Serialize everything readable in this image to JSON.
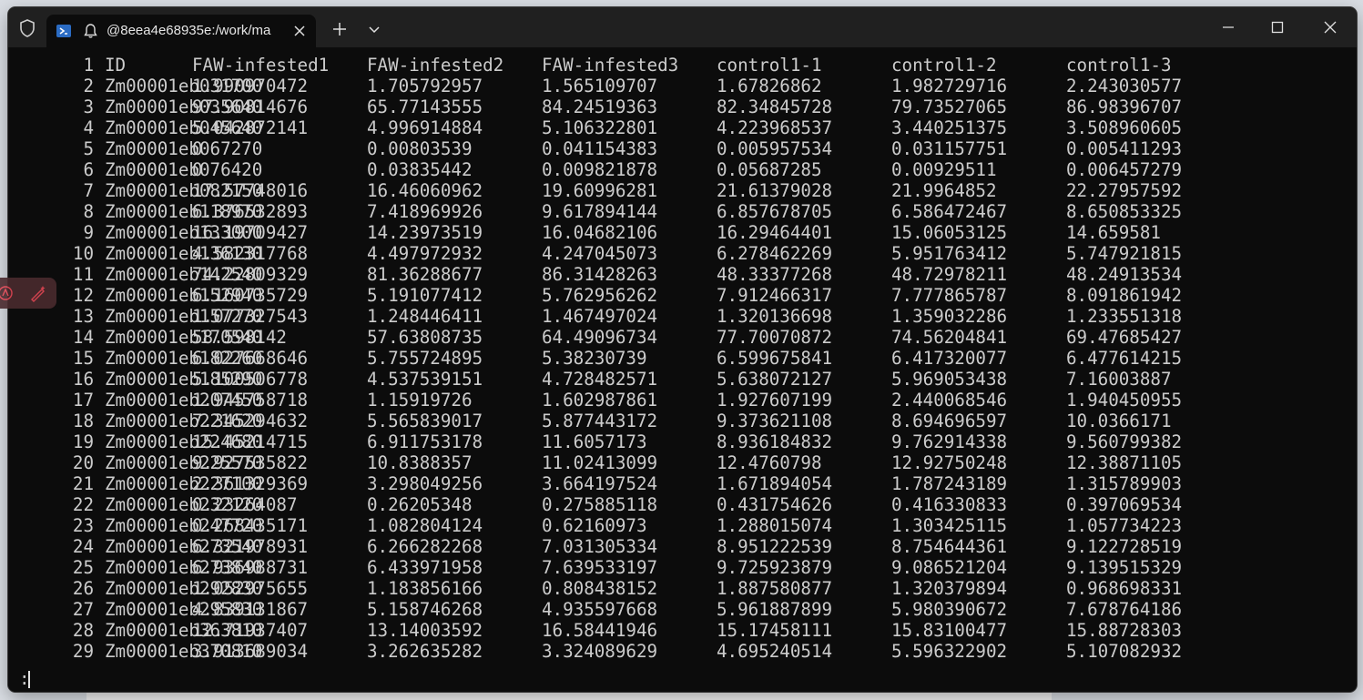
{
  "window": {
    "tab_title": "@8eea4e68935e:/work/ma"
  },
  "icons": {
    "shield": "shield-icon",
    "powershell": "powershell-icon",
    "bell": "bell-icon",
    "close_tab": "close-icon",
    "new_tab": "plus-icon",
    "dropdown": "chevron-down-icon",
    "minimize": "minimize-icon",
    "maximize": "maximize-icon",
    "close_window": "close-icon",
    "overlay_left": "accessibility-icon",
    "overlay_right": "pen-sparkle-icon"
  },
  "colors": {
    "terminal_bg": "#0c0c0c",
    "terminal_fg": "#cccccc",
    "titlebar_bg": "#202020",
    "overlay_accent": "#e74856"
  },
  "terminal": {
    "prompt": ":",
    "header": [
      "ID",
      "FAW-infested1",
      "FAW-infested2",
      "FAW-infested3",
      "control1-1",
      "control1-2",
      "control1-3"
    ],
    "rows": [
      {
        "line": "1",
        "cells": [
          "ID",
          "FAW-infested1",
          "FAW-infested2",
          "FAW-infested3",
          "control1-1",
          "control1-2",
          "control1-3"
        ]
      },
      {
        "line": "2",
        "cells": [
          "Zm00001eb031700",
          "1.990970472",
          "1.705792957",
          "1.565109707",
          "1.67826862",
          "1.982729716",
          "2.243030577"
        ]
      },
      {
        "line": "3",
        "cells": [
          "Zm00001eb035640",
          "97.90814676",
          "65.77143555",
          "84.24519363",
          "82.34845728",
          "79.73527065",
          "86.98396707"
        ]
      },
      {
        "line": "4",
        "cells": [
          "Zm00001eb045640",
          "5.042872141",
          "4.996914884",
          "5.106322801",
          "4.223968537",
          "3.440251375",
          "3.508960605"
        ]
      },
      {
        "line": "5",
        "cells": [
          "Zm00001eb067270",
          "0",
          "0.00803539",
          "0.041154383",
          "0.005957534",
          "0.031157751",
          "0.005411293"
        ]
      },
      {
        "line": "6",
        "cells": [
          "Zm00001eb076420",
          "0",
          "0.03835442",
          "0.009821878",
          "0.05687285",
          "0.00929511",
          "0.006457279"
        ]
      },
      {
        "line": "7",
        "cells": [
          "Zm00001eb082150",
          "17.57748016",
          "16.46060962",
          "19.60996281",
          "21.61379028",
          "21.9964852",
          "22.27957592"
        ]
      },
      {
        "line": "8",
        "cells": [
          "Zm00001eb118970",
          "6.376532893",
          "7.418969926",
          "9.617894144",
          "6.857678705",
          "6.586472467",
          "8.650853325"
        ]
      },
      {
        "line": "9",
        "cells": [
          "Zm00001eb133000",
          "16.19709427",
          "14.23973519",
          "16.04682106",
          "16.29464401",
          "15.06053125",
          "14.659581"
        ]
      },
      {
        "line": "10",
        "cells": [
          "Zm00001eb136130",
          "4.582317768",
          "4.497972932",
          "4.247045073",
          "6.278462269",
          "5.951763412",
          "5.747921815"
        ]
      },
      {
        "line": "11",
        "cells": [
          "Zm00001eb142540",
          "74.22809329",
          "81.36288677",
          "86.31428263",
          "48.33377268",
          "48.72978211",
          "48.24913534"
        ]
      },
      {
        "line": "12",
        "cells": [
          "Zm00001eb152940",
          "6.160735729",
          "5.191077412",
          "5.762956262",
          "7.912466317",
          "7.777865787",
          "8.091861942"
        ]
      },
      {
        "line": "13",
        "cells": [
          "Zm00001eb157270",
          "1.077327543",
          "1.248446411",
          "1.467497024",
          "1.320136698",
          "1.359032286",
          "1.233551318"
        ]
      },
      {
        "line": "14",
        "cells": [
          "Zm00001eb170540",
          "58.598142",
          "57.63808735",
          "64.49096734",
          "77.70070872",
          "74.56204841",
          "69.47685427"
        ]
      },
      {
        "line": "15",
        "cells": [
          "Zm00001eb182260",
          "6.027668646",
          "5.755724895",
          "5.38230739",
          "6.599675841",
          "6.417320077",
          "6.477614215"
        ]
      },
      {
        "line": "16",
        "cells": [
          "Zm00001eb185290",
          "5.100506778",
          "4.537539151",
          "4.728482571",
          "5.638072127",
          "5.969053438",
          "7.16003887"
        ]
      },
      {
        "line": "17",
        "cells": [
          "Zm00001eb207450",
          "1.945758718",
          "1.15919726",
          "1.602987861",
          "1.927607199",
          "2.440068546",
          "1.940450955"
        ]
      },
      {
        "line": "18",
        "cells": [
          "Zm00001eb221620",
          "7.345294632",
          "5.565839017",
          "5.877443172",
          "9.373621108",
          "8.694696597",
          "10.0366171"
        ]
      },
      {
        "line": "19",
        "cells": [
          "Zm00001eb224680",
          "15.45214715",
          "6.911753178",
          "11.6057173",
          "8.936184832",
          "9.762914338",
          "9.560799382"
        ]
      },
      {
        "line": "20",
        "cells": [
          "Zm00001eb225570",
          "9.927535822",
          "10.8388357",
          "11.02413099",
          "12.4760798",
          "12.92750248",
          "12.38871105"
        ]
      },
      {
        "line": "21",
        "cells": [
          "Zm00001eb227100",
          "2.361329369",
          "3.298049256",
          "3.664197524",
          "1.671894054",
          "1.787243189",
          "1.315789903"
        ]
      },
      {
        "line": "22",
        "cells": [
          "Zm00001eb232120",
          "0.23264087",
          "0.26205348",
          "0.275885118",
          "0.431754626",
          "0.416330833",
          "0.397069534"
        ]
      },
      {
        "line": "23",
        "cells": [
          "Zm00001eb247720",
          "0.268435171",
          "1.082804124",
          "0.62160973",
          "1.288015074",
          "1.303425115",
          "1.057734223"
        ]
      },
      {
        "line": "24",
        "cells": [
          "Zm00001eb273540",
          "6.321978931",
          "6.266282268",
          "7.031305334",
          "8.951222539",
          "8.754644361",
          "9.122728519"
        ]
      },
      {
        "line": "25",
        "cells": [
          "Zm00001eb273840",
          "6.936988731",
          "6.433971958",
          "7.639533197",
          "9.725923879",
          "9.086521204",
          "9.139515329"
        ]
      },
      {
        "line": "26",
        "cells": [
          "Zm00001eb292830",
          "1.052975655",
          "1.183856166",
          "0.808438152",
          "1.887580877",
          "1.320379894",
          "0.968698331"
        ]
      },
      {
        "line": "27",
        "cells": [
          "Zm00001eb295830",
          "4.839131867",
          "5.158746268",
          "4.935597668",
          "5.961887899",
          "5.980390672",
          "7.678764186"
        ]
      },
      {
        "line": "28",
        "cells": [
          "Zm00001eb363810",
          "12.71937407",
          "13.14003592",
          "16.58441946",
          "15.17458111",
          "15.83100477",
          "15.88728303"
        ]
      },
      {
        "line": "29",
        "cells": [
          "Zm00001eb370810",
          "3.913689034",
          "3.262635282",
          "3.324089629",
          "4.695240514",
          "5.596322902",
          "5.107082932"
        ]
      }
    ]
  }
}
